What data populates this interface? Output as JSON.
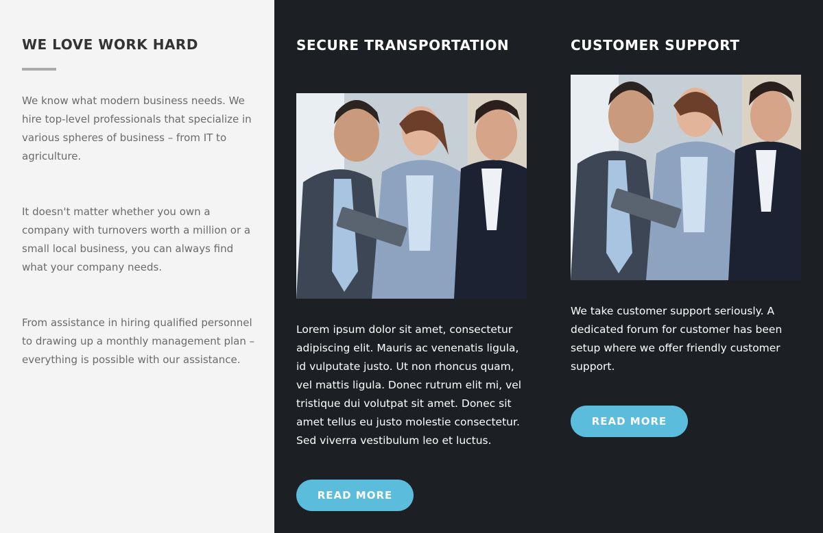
{
  "left": {
    "heading": "WE LOVE WORK HARD",
    "paragraphs": [
      "We know what modern business needs. We hire top-level professionals that specialize in various spheres of business – from IT to agriculture.",
      "It doesn't matter whether you own a company with turnovers worth a million or a small local business, you can always find what your company needs.",
      "From assistance in hiring qualified personnel to drawing up a monthly management plan – everything is possible with our assistance."
    ]
  },
  "columns": [
    {
      "title": "SECURE TRANSPORTATION",
      "body": "Lorem ipsum dolor sit amet, consectetur adipiscing elit. Mauris ac venenatis ligula, id vulputate justo. Ut non rhoncus quam, vel mattis ligula. Donec rutrum elit mi, vel tristique dui volutpat sit amet. Donec sit amet tellus eu justo molestie consectetur. Sed viverra vestibulum leo et luctus.",
      "button": "READ MORE"
    },
    {
      "title": "CUSTOMER SUPPORT",
      "body": "We take customer support seriously. A dedicated forum for customer has been setup where we offer friendly customer support.",
      "button": "READ MORE"
    }
  ],
  "colors": {
    "left_bg": "#f4f4f4",
    "dark_bg": "#1c2024",
    "accent": "#5bbcdc"
  }
}
